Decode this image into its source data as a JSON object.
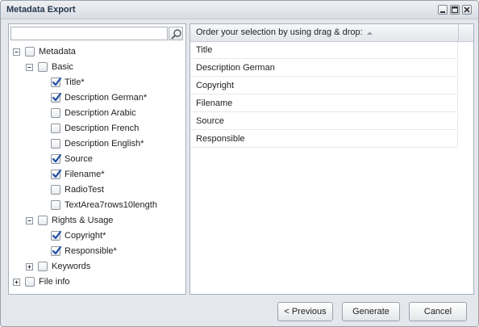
{
  "window": {
    "title": "Metadata Export"
  },
  "search": {
    "placeholder": "",
    "value": ""
  },
  "tree": {
    "nodes": [
      {
        "label": "Metadata",
        "level": 0,
        "expander": "minus",
        "checked": false
      },
      {
        "label": "Basic",
        "level": 1,
        "expander": "minus",
        "checked": false
      },
      {
        "label": "Title*",
        "level": 2,
        "expander": "none",
        "checked": true
      },
      {
        "label": "Description German*",
        "level": 2,
        "expander": "none",
        "checked": true
      },
      {
        "label": "Description Arabic",
        "level": 2,
        "expander": "none",
        "checked": false
      },
      {
        "label": "Description French",
        "level": 2,
        "expander": "none",
        "checked": false
      },
      {
        "label": "Description English*",
        "level": 2,
        "expander": "none",
        "checked": false
      },
      {
        "label": "Source",
        "level": 2,
        "expander": "none",
        "checked": true
      },
      {
        "label": "Filename*",
        "level": 2,
        "expander": "none",
        "checked": true
      },
      {
        "label": "RadioTest",
        "level": 2,
        "expander": "none",
        "checked": false
      },
      {
        "label": "TextArea7rows10length",
        "level": 2,
        "expander": "none",
        "checked": false
      },
      {
        "label": "Rights & Usage",
        "level": 1,
        "expander": "minus",
        "checked": false
      },
      {
        "label": "Copyright*",
        "level": 2,
        "expander": "none",
        "checked": true
      },
      {
        "label": "Responsible*",
        "level": 2,
        "expander": "none",
        "checked": true
      },
      {
        "label": "Keywords",
        "level": 1,
        "expander": "plus",
        "checked": false
      },
      {
        "label": "File info",
        "level": 0,
        "expander": "plus",
        "checked": false
      }
    ]
  },
  "grid": {
    "header": "Order your selection by using drag & drop:",
    "sort_icon": "sort-asc-icon",
    "rows": [
      "Title",
      "Description German",
      "Copyright",
      "Filename",
      "Source",
      "Responsible"
    ]
  },
  "buttons": {
    "previous": "< Previous",
    "generate": "Generate",
    "cancel": "Cancel"
  },
  "window_controls": [
    "minimize-icon",
    "maximize-icon",
    "close-icon"
  ],
  "colors": {
    "check": "#1f4fa8",
    "title": "#25384f",
    "background": "#e4e7ec"
  }
}
